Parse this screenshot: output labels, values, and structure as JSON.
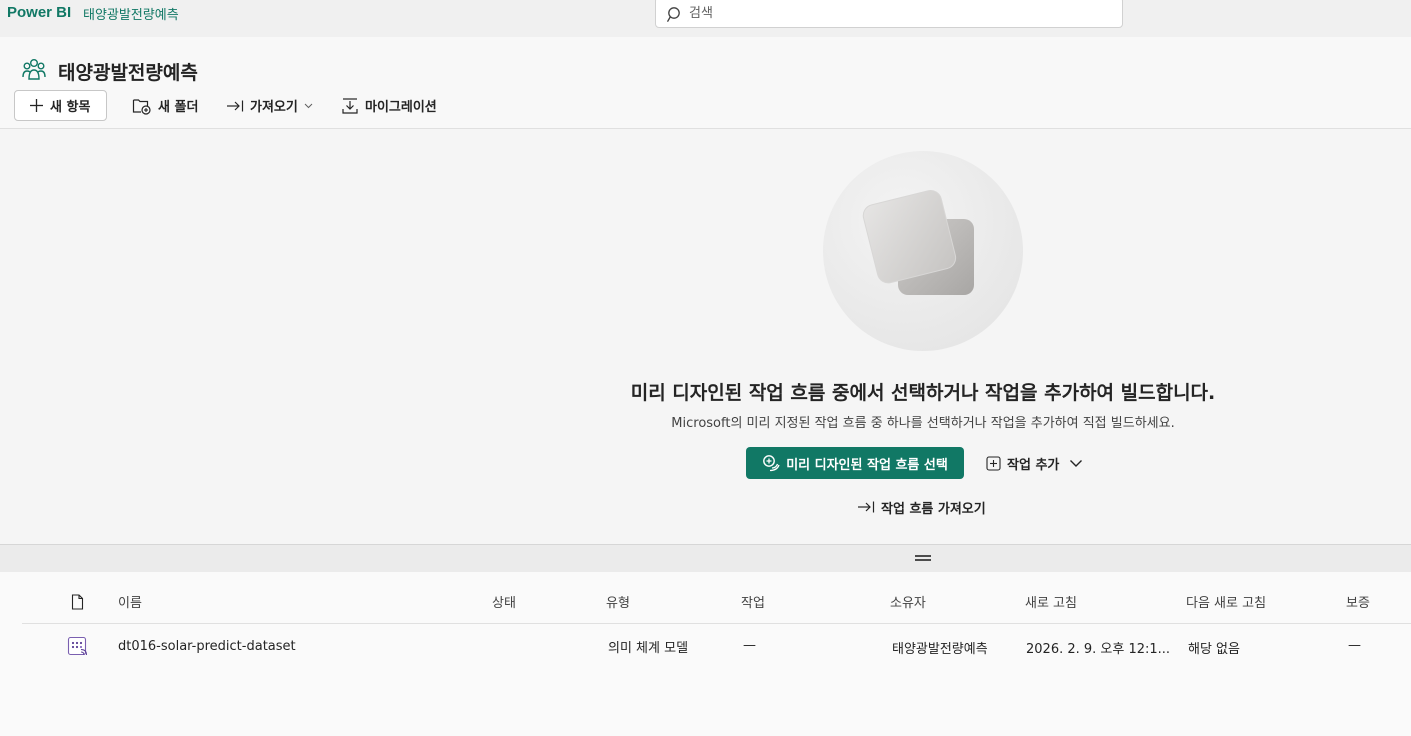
{
  "app": {
    "brand": "Power BI",
    "breadcrumb": "태양광발전량예측"
  },
  "search": {
    "placeholder": "검색"
  },
  "workspace": {
    "title": "태양광발전량예측"
  },
  "toolbar": {
    "new_item": "새 항목",
    "new_folder": "새 폴더",
    "import": "가져오기",
    "migrate": "마이그레이션"
  },
  "empty_state": {
    "title": "미리 디자인된 작업 흐름 중에서 선택하거나 작업을 추가하여 빌드합니다.",
    "subtitle": "Microsoft의 미리 지정된 작업 흐름 중 하나를 선택하거나 작업을 추가하여 직접 빌드하세요.",
    "primary_button": "미리 디자인된 작업 흐름 선택",
    "add_task": "작업 추가",
    "import_flow": "작업 흐름 가져오기"
  },
  "table": {
    "columns": [
      "이름",
      "상태",
      "유형",
      "작업",
      "소유자",
      "새로 고침",
      "다음 새로 고침",
      "보증"
    ],
    "rows": [
      {
        "name": "dt016-solar-predict-dataset",
        "status": "",
        "type": "의미 체계 모델",
        "task": "—",
        "owner": "태양광발전량예측",
        "refreshed": "2026. 2. 9. 오후 12:1...",
        "next_refresh": "해당 없음",
        "endorsement": "—"
      }
    ]
  },
  "icons": {
    "search": "search-icon",
    "workspace": "workspace-people-icon",
    "new_item": "plus-icon",
    "new_folder": "folder-add-icon",
    "import": "import-arrow-icon",
    "migrate": "migrate-icon",
    "dataset": "semantic-model-icon"
  },
  "colors": {
    "accent": "#117865",
    "background": "#f5f5f5"
  }
}
